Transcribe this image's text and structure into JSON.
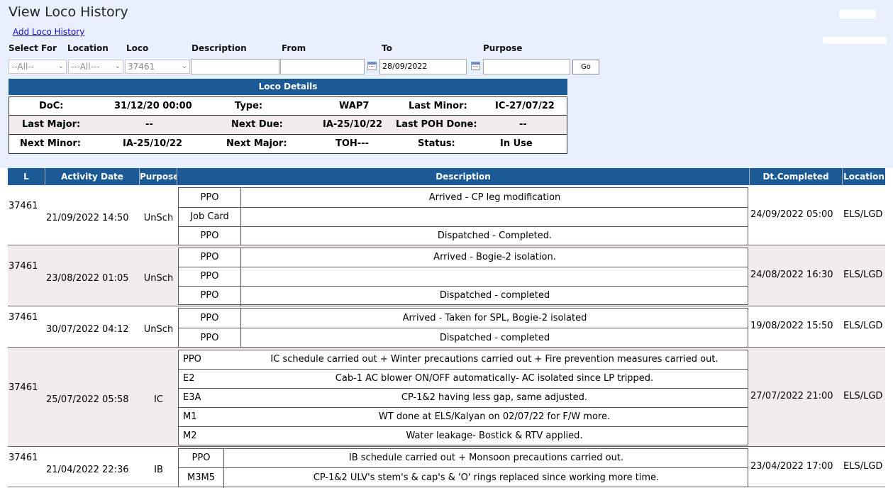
{
  "header": {
    "title": "View Loco History",
    "add_link": "Add Loco History"
  },
  "filters": {
    "labels": {
      "select_for": "Select For",
      "location": "Location",
      "loco": "Loco",
      "description": "Description",
      "from": "From",
      "to": "To",
      "purpose": "Purpose"
    },
    "select_for_value": "--All--",
    "location_value": "---All---",
    "loco_value": "37461",
    "description_value": "",
    "from_value": "",
    "to_value": "28/09/2022",
    "purpose_value": "",
    "go_label": "Go"
  },
  "loco_details": {
    "title": "Loco Details",
    "rows": [
      [
        {
          "label": "DoC:",
          "value": "31/12/20 00:00"
        },
        {
          "label": "Type:",
          "value": "WAP7"
        },
        {
          "label": "Last Minor:",
          "value": "IC-27/07/22"
        }
      ],
      [
        {
          "label": "Last Major:",
          "value": "--"
        },
        {
          "label": "Next Due:",
          "value": "IA-25/10/22"
        },
        {
          "label": "Last POH Done:",
          "value": "--"
        }
      ],
      [
        {
          "label": "Next Minor:",
          "value": "IA-25/10/22"
        },
        {
          "label": "Next Major:",
          "value": "TOH---"
        },
        {
          "label": "Status:",
          "value": "In Use"
        }
      ]
    ]
  },
  "table": {
    "columns": [
      "L",
      "Activity Date",
      "Purpose",
      "Description",
      "Dt.Completed",
      "Location"
    ],
    "rows": [
      {
        "loco": "37461",
        "activity_date": "21/09/2022 14:50",
        "purpose": "UnSch",
        "completed": "24/09/2022 05:00",
        "location": "ELS/LGD",
        "items": [
          {
            "code": "PPO",
            "desc": "Arrived - CP leg modification"
          },
          {
            "code": "Job Card",
            "desc": ""
          },
          {
            "code": "PPO",
            "desc": "Dispatched - Completed."
          }
        ]
      },
      {
        "loco": "37461",
        "activity_date": "23/08/2022 01:05",
        "purpose": "UnSch",
        "completed": "24/08/2022 16:30",
        "location": "ELS/LGD",
        "items": [
          {
            "code": "PPO",
            "desc": "Arrived - Bogie-2 isolation."
          },
          {
            "code": "PPO",
            "desc": ""
          },
          {
            "code": "PPO",
            "desc": "Dispatched - completed"
          }
        ]
      },
      {
        "loco": "37461",
        "activity_date": "30/07/2022 04:12",
        "purpose": "UnSch",
        "completed": "19/08/2022 15:50",
        "location": "ELS/LGD",
        "items": [
          {
            "code": "PPO",
            "desc": "Arrived - Taken for SPL, Bogie-2 isolated"
          },
          {
            "code": "PPO",
            "desc": "Dispatched - completed"
          }
        ]
      },
      {
        "loco": "37461",
        "activity_date": "25/07/2022 05:58",
        "purpose": "IC",
        "completed": "27/07/2022 21:00",
        "location": "ELS/LGD",
        "items": [
          {
            "code": "PPO",
            "desc": "IC schedule carried out + Winter precautions carried out + Fire prevention measures carried out."
          },
          {
            "code": "E2",
            "desc": "Cab-1 AC blower ON/OFF automatically- AC isolated since LP tripped."
          },
          {
            "code": "E3A",
            "desc": "CP-1&2 having less gap, same adjusted."
          },
          {
            "code": "M1",
            "desc": "WT done at ELS/Kalyan on 02/07/22 for F/W more."
          },
          {
            "code": "M2",
            "desc": "Water leakage- Bostick & RTV applied."
          }
        ]
      },
      {
        "loco": "37461",
        "activity_date": "21/04/2022 22:36",
        "purpose": "IB",
        "completed": "23/04/2022 17:00",
        "location": "ELS/LGD",
        "items": [
          {
            "code": "PPO",
            "desc": "IB schedule carried out + Monsoon precautions carried out."
          },
          {
            "code": "M3M5",
            "desc": "CP-1&2 ULV's stem's & cap's & 'O' rings replaced since working more time."
          }
        ]
      }
    ]
  }
}
